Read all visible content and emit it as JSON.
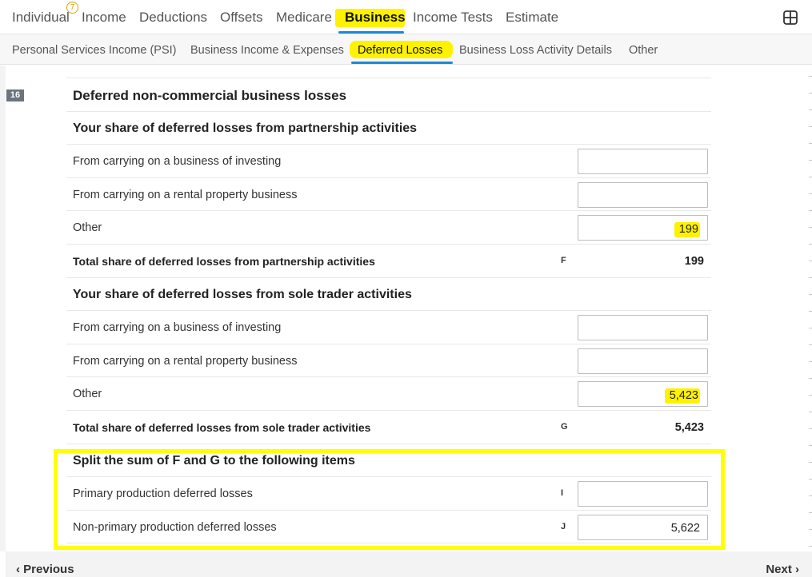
{
  "top_tabs": [
    "Individual",
    "Income",
    "Deductions",
    "Offsets",
    "Medicare",
    "Business",
    "Income Tests",
    "Estimate"
  ],
  "top_badge": "7",
  "sub_tabs": [
    "Personal Services Income (PSI)",
    "Business Income & Expenses",
    "Deferred Losses",
    "Business Loss Activity Details",
    "Other"
  ],
  "section_number": "16",
  "form": {
    "title": "Deferred non-commercial business losses",
    "partnership": {
      "heading": "Your share of deferred losses from partnership activities",
      "investing_label": "From carrying on a business of investing",
      "investing_value": "",
      "rental_label": "From carrying on a rental property business",
      "rental_value": "",
      "other_label": "Other",
      "other_value": "199",
      "total_label": "Total share of deferred losses from partnership activities",
      "total_code": "F",
      "total_value": "199"
    },
    "sole_trader": {
      "heading": "Your share of deferred losses from sole trader activities",
      "investing_label": "From carrying on a business of investing",
      "investing_value": "",
      "rental_label": "From carrying on a rental property business",
      "rental_value": "",
      "other_label": "Other",
      "other_value": "5,423",
      "total_label": "Total share of deferred losses from sole trader activities",
      "total_code": "G",
      "total_value": "5,423"
    },
    "split": {
      "heading": "Split the sum of F and G to the following items",
      "primary_label": "Primary production deferred losses",
      "primary_code": "I",
      "primary_value": "",
      "non_primary_label": "Non-primary production deferred losses",
      "non_primary_code": "J",
      "non_primary_value": "5,622"
    }
  },
  "footer": {
    "previous": "Previous",
    "next": "Next"
  },
  "colors": {
    "highlight": "#fff200",
    "active_underline": "#1a8ad4",
    "annotation_box": "#ffff00"
  }
}
